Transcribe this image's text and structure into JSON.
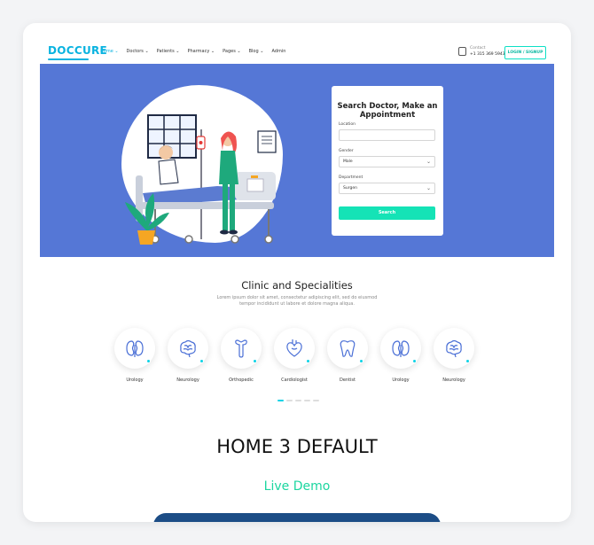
{
  "nav": {
    "logo": "DOCCURE",
    "menu": [
      "Home ⌄",
      "Doctors ⌄",
      "Patients ⌄",
      "Pharmacy ⌄",
      "Pages ⌄",
      "Blog ⌄",
      "Admin"
    ],
    "active_index": 0,
    "contact_label": "Contact",
    "contact_number": "+1 315 369 5943",
    "login_label": "LOGIN / SIGNUP"
  },
  "hero": {
    "form": {
      "title": "Search Doctor, Make an Appointment",
      "location_label": "Location",
      "location_value": "",
      "gender_label": "Gender",
      "gender_value": "Male",
      "department_label": "Department",
      "department_value": "Surgen",
      "search_label": "Search"
    }
  },
  "specialities": {
    "title": "Clinic and Specialities",
    "subtitle": "Lorem ipsum dolor sit amet, consectetur adipiscing elit, sed do eiusmod tempor incididunt ut labore et dolore magna aliqua.",
    "items": [
      "Urology",
      "Neurology",
      "Orthopedic",
      "Cardiologist",
      "Dentist",
      "Urology",
      "Neurology"
    ],
    "icons": [
      "kidney-icon",
      "brain-icon",
      "bone-icon",
      "heart-icon",
      "tooth-icon",
      "kidney-icon",
      "brain-icon"
    ]
  },
  "page_heading": "HOME 3 DEFAULT",
  "live_demo": "Live Demo",
  "colors": {
    "primary": "#09b3e0",
    "hero_bg": "#5577d6",
    "accent": "#15e3b6",
    "demo_text": "#1cd6a0",
    "bottom_bar": "#1c4d86"
  }
}
